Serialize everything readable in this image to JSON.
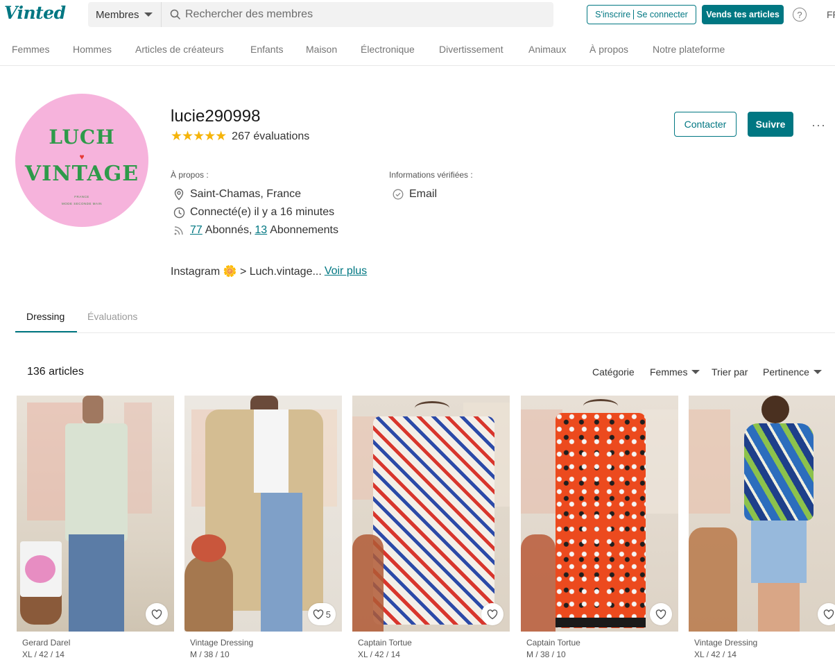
{
  "header": {
    "logo": "Vinted",
    "search_select": "Membres",
    "search_placeholder": "Rechercher des membres",
    "signup": "S'inscrire",
    "login": "Se connecter",
    "sell": "Vends tes articles",
    "lang": "FR"
  },
  "nav": [
    "Femmes",
    "Hommes",
    "Articles de créateurs",
    "Enfants",
    "Maison",
    "Électronique",
    "Divertissement",
    "Animaux",
    "À propos",
    "Notre plateforme"
  ],
  "profile": {
    "avatar": {
      "line1": "LUCH",
      "line2": "VINTAGE",
      "small1": "FRANCE",
      "small2": "MODE SECONDE MAIN"
    },
    "username": "lucie290998",
    "stars": "★★★★★",
    "reviews": "267 évaluations",
    "about_label": "À propos :",
    "location": "Saint-Chamas, France",
    "last_seen": "Connecté(e) il y a 16 minutes",
    "followers": "77",
    "followers_label": "Abonnés,",
    "following": "13",
    "following_label": "Abonnements",
    "verified_label": "Informations vérifiées :",
    "verified_email": "Email",
    "bio": "Instagram 🌼 > Luch.vintage...",
    "see_more": "Voir plus",
    "contact": "Contacter",
    "follow": "Suivre",
    "more": "···"
  },
  "tabs": [
    "Dressing",
    "Évaluations"
  ],
  "listing": {
    "count": "136 articles",
    "category_label": "Catégorie",
    "category_value": "Femmes",
    "sort_label": "Trier par",
    "sort_value": "Pertinence"
  },
  "items": [
    {
      "brand": "Gerard Darel",
      "size": "XL / 42 / 14",
      "favs": ""
    },
    {
      "brand": "Vintage Dressing",
      "size": "M / 38 / 10",
      "favs": "5"
    },
    {
      "brand": "Captain Tortue",
      "size": "XL / 42 / 14",
      "favs": ""
    },
    {
      "brand": "Captain Tortue",
      "size": "M / 38 / 10",
      "favs": ""
    },
    {
      "brand": "Vintage Dressing",
      "size": "XL / 42 / 14",
      "favs": ""
    }
  ],
  "colors": {
    "brand": "#007782",
    "star": "#f5b40a",
    "avatar_bg": "#f6b3dc",
    "avatar_text": "#2e9a4a"
  }
}
